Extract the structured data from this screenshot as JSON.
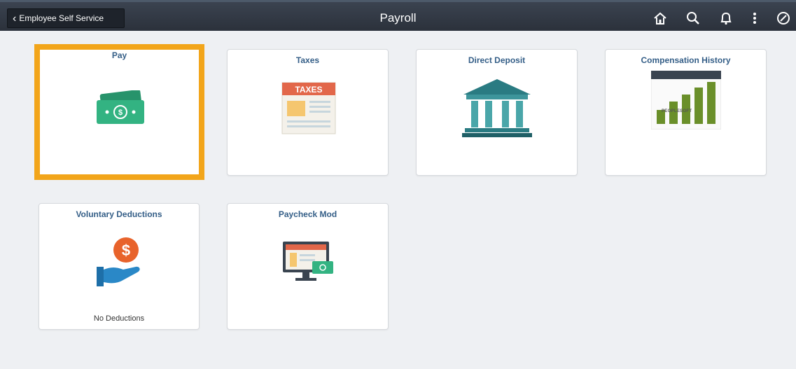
{
  "header": {
    "back_label": "Employee Self Service",
    "title": "Payroll",
    "icons": [
      "home-icon",
      "search-icon",
      "notification-bell-icon",
      "actions-menu-icon",
      "navbar-compass-icon"
    ]
  },
  "tiles": [
    {
      "title": "Pay",
      "icon": "money-icon",
      "footer": "",
      "selected": true
    },
    {
      "title": "Taxes",
      "icon": "taxes-document-icon",
      "footer": "",
      "badge": "TAXES"
    },
    {
      "title": "Direct Deposit",
      "icon": "bank-icon",
      "footer": ""
    },
    {
      "title": "Compensation History",
      "icon": "compensation-chart-icon",
      "footer": "",
      "label": "PEOPLESOFT"
    },
    {
      "title": "Voluntary Deductions",
      "icon": "hand-dollar-icon",
      "footer": "No Deductions"
    },
    {
      "title": "Paycheck Mod",
      "icon": "paycheck-monitor-icon",
      "footer": ""
    }
  ],
  "colors": {
    "header_bg": "#2f3540",
    "tile_title": "#345e87",
    "selection": "#f2a51a",
    "money_green": "#2ea67a",
    "deduction_orange": "#e8632b",
    "deduction_blue": "#1e6fa8"
  }
}
